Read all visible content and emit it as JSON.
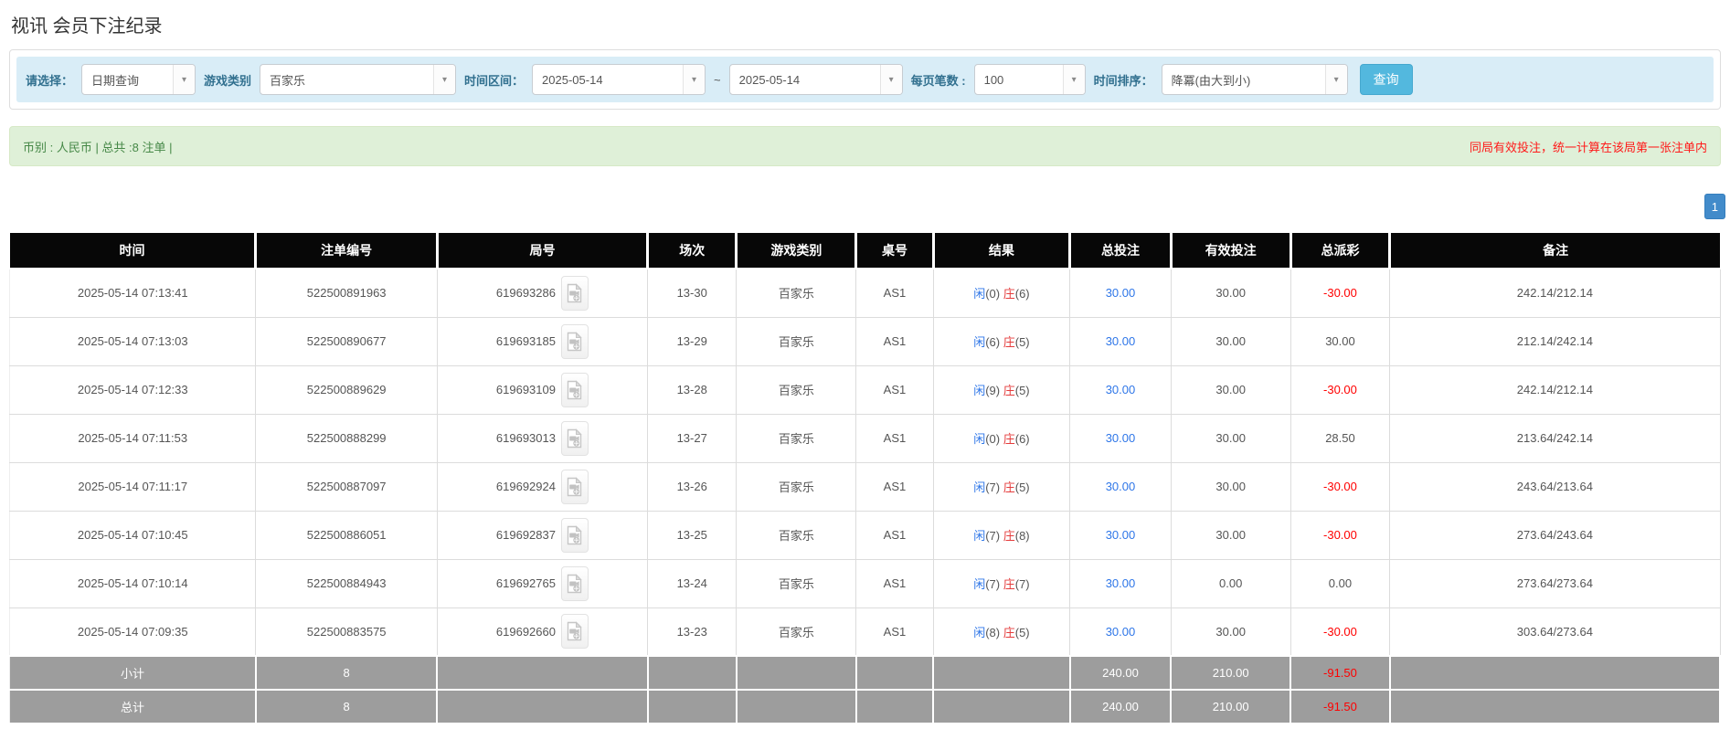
{
  "page": {
    "title": "视讯 会员下注纪录"
  },
  "filters": {
    "query_type_label": "请选择：",
    "query_type_value": "日期查询",
    "game_type_label": "游戏类别",
    "game_type_value": "百家乐",
    "time_range_label": "时间区间：",
    "time_from": "2025-05-14",
    "time_to": "2025-05-14",
    "range_separator": "~",
    "page_size_label": "每页笔数 :",
    "page_size_value": "100",
    "sort_label": "时间排序：",
    "sort_value": "降冪(由大到小)",
    "search_button": "查询"
  },
  "summary": {
    "left_text": "币别 : 人民币 | 总共 :8 注单 |",
    "right_notice": "同局有效投注，统一计算在该局第一张注单内"
  },
  "pagination": {
    "current_page": "1"
  },
  "table": {
    "columns": [
      "时间",
      "注单编号",
      "局号",
      "场次",
      "游戏类别",
      "桌号",
      "结果",
      "总投注",
      "有效投注",
      "总派彩",
      "备注"
    ],
    "result_labels": {
      "player": "闲",
      "banker": "庄"
    },
    "rows": [
      {
        "time": "2025-05-14 07:13:41",
        "bet_id": "522500891963",
        "round_id": "619693286",
        "session": "13-30",
        "game": "百家乐",
        "table_no": "AS1",
        "player": "(0)",
        "banker": "(6)",
        "total_bet": "30.00",
        "valid_bet": "30.00",
        "payout": "-30.00",
        "remark": "242.14/212.14"
      },
      {
        "time": "2025-05-14 07:13:03",
        "bet_id": "522500890677",
        "round_id": "619693185",
        "session": "13-29",
        "game": "百家乐",
        "table_no": "AS1",
        "player": "(6)",
        "banker": "(5)",
        "total_bet": "30.00",
        "valid_bet": "30.00",
        "payout": "30.00",
        "remark": "212.14/242.14"
      },
      {
        "time": "2025-05-14 07:12:33",
        "bet_id": "522500889629",
        "round_id": "619693109",
        "session": "13-28",
        "game": "百家乐",
        "table_no": "AS1",
        "player": "(9)",
        "banker": "(5)",
        "total_bet": "30.00",
        "valid_bet": "30.00",
        "payout": "-30.00",
        "remark": "242.14/212.14"
      },
      {
        "time": "2025-05-14 07:11:53",
        "bet_id": "522500888299",
        "round_id": "619693013",
        "session": "13-27",
        "game": "百家乐",
        "table_no": "AS1",
        "player": "(0)",
        "banker": "(6)",
        "total_bet": "30.00",
        "valid_bet": "30.00",
        "payout": "28.50",
        "remark": "213.64/242.14"
      },
      {
        "time": "2025-05-14 07:11:17",
        "bet_id": "522500887097",
        "round_id": "619692924",
        "session": "13-26",
        "game": "百家乐",
        "table_no": "AS1",
        "player": "(7)",
        "banker": "(5)",
        "total_bet": "30.00",
        "valid_bet": "30.00",
        "payout": "-30.00",
        "remark": "243.64/213.64"
      },
      {
        "time": "2025-05-14 07:10:45",
        "bet_id": "522500886051",
        "round_id": "619692837",
        "session": "13-25",
        "game": "百家乐",
        "table_no": "AS1",
        "player": "(7)",
        "banker": "(8)",
        "total_bet": "30.00",
        "valid_bet": "30.00",
        "payout": "-30.00",
        "remark": "273.64/243.64"
      },
      {
        "time": "2025-05-14 07:10:14",
        "bet_id": "522500884943",
        "round_id": "619692765",
        "session": "13-24",
        "game": "百家乐",
        "table_no": "AS1",
        "player": "(7)",
        "banker": "(7)",
        "total_bet": "30.00",
        "valid_bet": "0.00",
        "payout": "0.00",
        "remark": "273.64/273.64"
      },
      {
        "time": "2025-05-14 07:09:35",
        "bet_id": "522500883575",
        "round_id": "619692660",
        "session": "13-23",
        "game": "百家乐",
        "table_no": "AS1",
        "player": "(8)",
        "banker": "(5)",
        "total_bet": "30.00",
        "valid_bet": "30.00",
        "payout": "-30.00",
        "remark": "303.64/273.64"
      }
    ],
    "totals": [
      {
        "label": "小计",
        "count": "8",
        "total_bet": "240.00",
        "valid_bet": "210.00",
        "payout": "-91.50"
      },
      {
        "label": "总计",
        "count": "8",
        "total_bet": "240.00",
        "valid_bet": "210.00",
        "payout": "-91.50"
      }
    ]
  },
  "colors": {
    "accent_blue": "#53b8de",
    "link_blue": "#2e76e8",
    "banker_red": "#e43b3b",
    "loss_red": "#ff0000",
    "success_green": "#468847",
    "header_bg": "#070707",
    "totals_gray": "#9d9d9d",
    "filter_bar_bg": "#d9edf7",
    "summary_bar_bg": "#dff0d8"
  }
}
